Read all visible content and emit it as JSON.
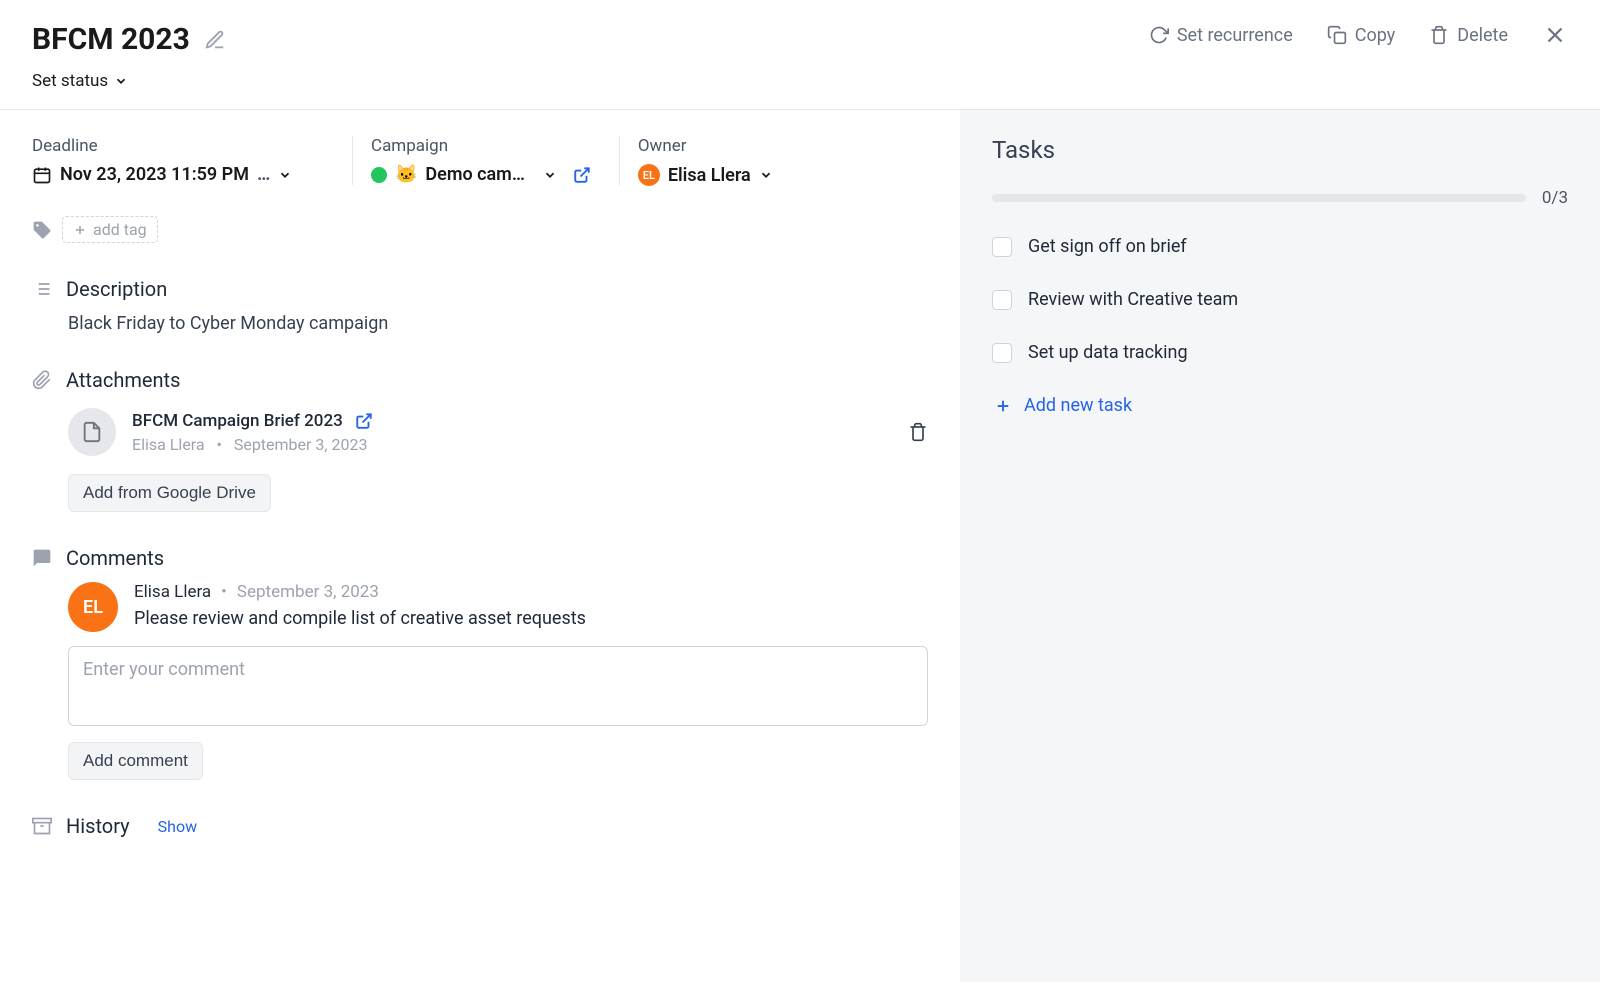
{
  "header": {
    "title": "BFCM 2023",
    "set_status_label": "Set status",
    "actions": {
      "set_recurrence": "Set recurrence",
      "copy": "Copy",
      "delete": "Delete"
    }
  },
  "meta": {
    "deadline_label": "Deadline",
    "deadline_value": "Nov 23, 2023 11:59 PM",
    "campaign_label": "Campaign",
    "campaign_value": "Demo cam…",
    "campaign_emoji": "🐱",
    "owner_label": "Owner",
    "owner_name": "Elisa Llera",
    "owner_initials": "EL"
  },
  "tags": {
    "add_tag_label": "add tag"
  },
  "description": {
    "heading": "Description",
    "text": "Black Friday to Cyber Monday campaign"
  },
  "attachments": {
    "heading": "Attachments",
    "file": {
      "name": "BFCM Campaign Brief 2023",
      "author": "Elisa Llera",
      "date": "September 3, 2023"
    },
    "add_button": "Add from Google Drive"
  },
  "comments": {
    "heading": "Comments",
    "items": [
      {
        "author": "Elisa Llera",
        "initials": "EL",
        "date": "September 3, 2023",
        "text": "Please review and compile list of creative asset requests"
      }
    ],
    "input_placeholder": "Enter your comment",
    "add_button": "Add comment"
  },
  "history": {
    "heading": "History",
    "show": "Show"
  },
  "tasks": {
    "heading": "Tasks",
    "progress": "0/3",
    "items": [
      "Get sign off on brief",
      "Review with Creative team",
      "Set up data tracking"
    ],
    "add_label": "Add new task"
  }
}
